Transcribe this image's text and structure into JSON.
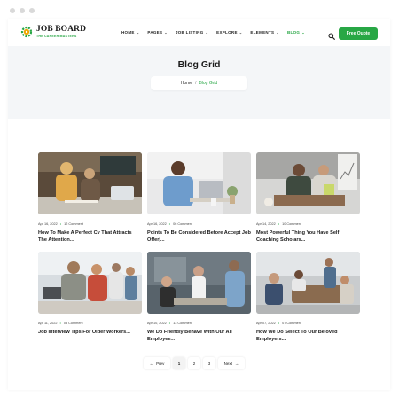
{
  "header": {
    "brand_title": "JOB BOARD",
    "brand_tagline": "THE CAREER MASTERS",
    "menu": [
      {
        "label": "HOME",
        "active": false
      },
      {
        "label": "PAGES",
        "active": false
      },
      {
        "label": "JOB LISTING",
        "active": false
      },
      {
        "label": "EXPLORE",
        "active": false
      },
      {
        "label": "ELEMENTS",
        "active": false
      },
      {
        "label": "BLOG",
        "active": true
      }
    ],
    "cta_label": "Free Quote",
    "accent_color": "#28a745"
  },
  "hero": {
    "title": "Blog Grid",
    "breadcrumb": {
      "home": "Home",
      "separator": "/",
      "current": "Blog Grid"
    }
  },
  "posts": [
    {
      "date": "Apr 16, 2022",
      "comments": "12 Comment",
      "title": "How To Make A Perfect Cv That Attracts The Attention..."
    },
    {
      "date": "Apr 16, 2022",
      "comments": "06 Comment",
      "title": "Points To Be Considered Before Accept Job Offer|..."
    },
    {
      "date": "Apr 14, 2022",
      "comments": "10 Comment",
      "title": "Most Powerful Thing You Have Self Coaching Scholars..."
    },
    {
      "date": "Apr 11, 2022",
      "comments": "08 Comment",
      "title": "Job Interview Tips For Older Workers..."
    },
    {
      "date": "Apr 10, 2022",
      "comments": "13 Comment",
      "title": "We Do Friendly Behave With Our All Employee..."
    },
    {
      "date": "Apr 07, 2022",
      "comments": "07 Comment",
      "title": "How We Do Select To Our Beloved Employers..."
    }
  ],
  "pagination": {
    "prev": "Prev",
    "pages": [
      "1",
      "2",
      "3"
    ],
    "current": "1",
    "next": "Next"
  }
}
